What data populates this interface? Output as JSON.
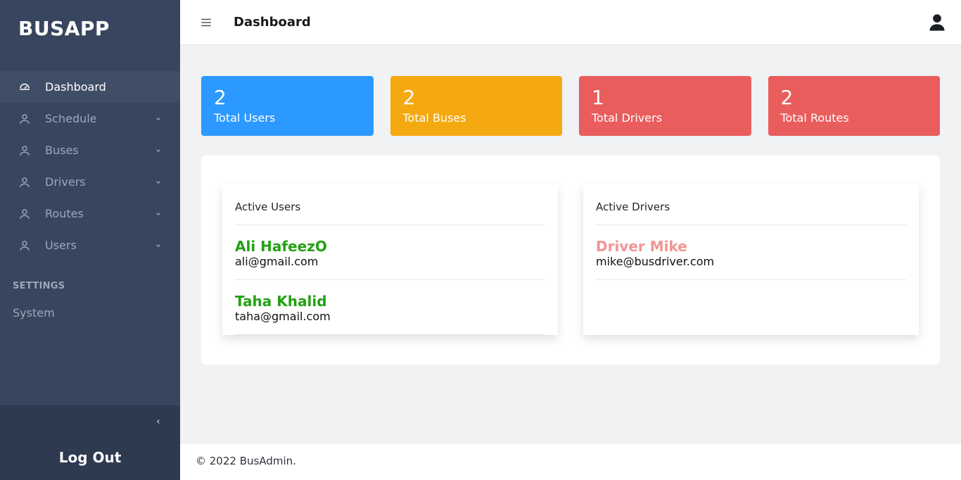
{
  "brand": "BUSAPP",
  "page_title": "Dashboard",
  "sidebar": {
    "items": [
      {
        "label": "Dashboard",
        "icon": "dashboard-icon",
        "expandable": false,
        "active": true
      },
      {
        "label": "Schedule",
        "icon": "user-icon",
        "expandable": true,
        "active": false
      },
      {
        "label": "Buses",
        "icon": "user-icon",
        "expandable": true,
        "active": false
      },
      {
        "label": "Drivers",
        "icon": "user-icon",
        "expandable": true,
        "active": false
      },
      {
        "label": "Routes",
        "icon": "user-icon",
        "expandable": true,
        "active": false
      },
      {
        "label": "Users",
        "icon": "user-icon",
        "expandable": true,
        "active": false
      }
    ],
    "settings_header": "SETTINGS",
    "settings_items": [
      {
        "label": "System"
      }
    ],
    "logout": "Log Out"
  },
  "stats": [
    {
      "value": "2",
      "label": "Total Users",
      "color": "blue"
    },
    {
      "value": "2",
      "label": "Total Buses",
      "color": "yellow"
    },
    {
      "value": "1",
      "label": "Total Drivers",
      "color": "red"
    },
    {
      "value": "2",
      "label": "Total Routes",
      "color": "red"
    }
  ],
  "active_users": {
    "title": "Active Users",
    "items": [
      {
        "name": "Ali HafeezO",
        "email": "ali@gmail.com"
      },
      {
        "name": "Taha Khalid",
        "email": "taha@gmail.com"
      }
    ]
  },
  "active_drivers": {
    "title": "Active Drivers",
    "items": [
      {
        "name": "Driver Mike",
        "email": "mike@busdriver.com"
      }
    ]
  },
  "footer": "© 2022 BusAdmin."
}
